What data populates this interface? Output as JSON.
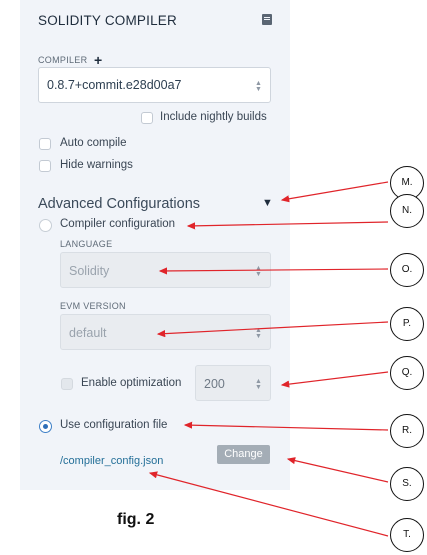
{
  "panel": {
    "title": "SOLIDITY COMPILER",
    "compiler_label": "COMPILER",
    "compiler_plus": "+",
    "compiler_version": "0.8.7+commit.e28d00a7",
    "include_nightly_label": "Include nightly builds",
    "auto_compile_label": "Auto compile",
    "hide_warnings_label": "Hide warnings",
    "advanced_title": "Advanced Configurations",
    "compiler_configuration_label": "Compiler configuration",
    "language_label": "LANGUAGE",
    "language_value": "Solidity",
    "evm_version_label": "EVM VERSION",
    "evm_version_value": "default",
    "enable_optimization_label": "Enable optimization",
    "optimization_runs": "200",
    "use_config_file_label": "Use configuration file",
    "config_file_path": "/compiler_config.json",
    "change_button": "Change"
  },
  "state": {
    "include_nightly": false,
    "auto_compile": false,
    "hide_warnings": false,
    "enable_optimization": false,
    "selected_mode": "Use configuration file",
    "advanced_expanded": true
  },
  "caption": "fig. 2",
  "callouts": [
    "M.",
    "N.",
    "O.",
    "P.",
    "Q.",
    "R.",
    "S.",
    "T."
  ],
  "icons": {
    "file": "file-icon",
    "plus": "plus-icon",
    "select_chevron": "up-down-chevron-icon",
    "caret": "chevron-down-icon"
  },
  "colors": {
    "panel_bg": "#f1f4f9",
    "link": "#246f98",
    "radio_on": "#2f6fb8",
    "change_button_bg": "#a4adb6",
    "arrow": "#e0242a"
  }
}
